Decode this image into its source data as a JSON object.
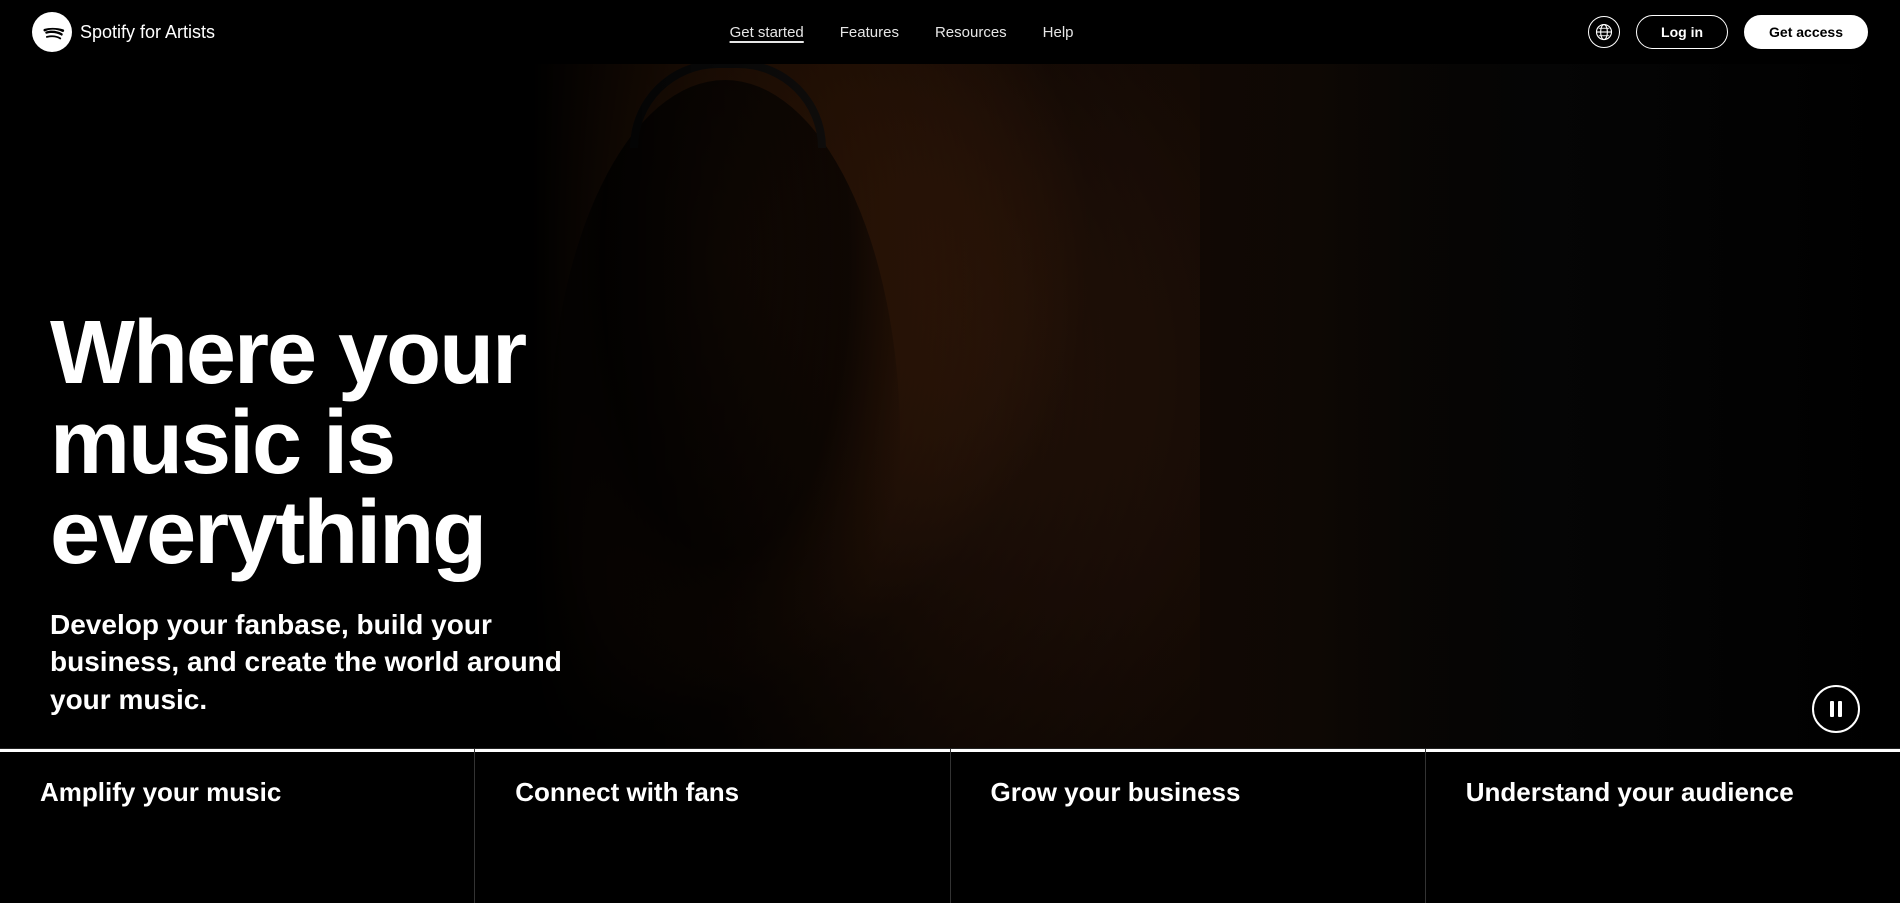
{
  "brand": {
    "logo_alt": "Spotify logo",
    "name": "Spotify",
    "suffix": " for Artists"
  },
  "navbar": {
    "links": [
      {
        "label": "Get started",
        "active": true
      },
      {
        "label": "Features",
        "active": false
      },
      {
        "label": "Resources",
        "active": false
      },
      {
        "label": "Help",
        "active": false
      }
    ],
    "login_label": "Log in",
    "get_access_label": "Get access"
  },
  "hero": {
    "title": "Where your music is everything",
    "subtitle": "Develop your fanbase, build your business, and create the world around your music."
  },
  "features": [
    {
      "title": "Amplify your music"
    },
    {
      "title": "Connect with fans"
    },
    {
      "title": "Grow your business"
    },
    {
      "title": "Understand your audience"
    }
  ]
}
